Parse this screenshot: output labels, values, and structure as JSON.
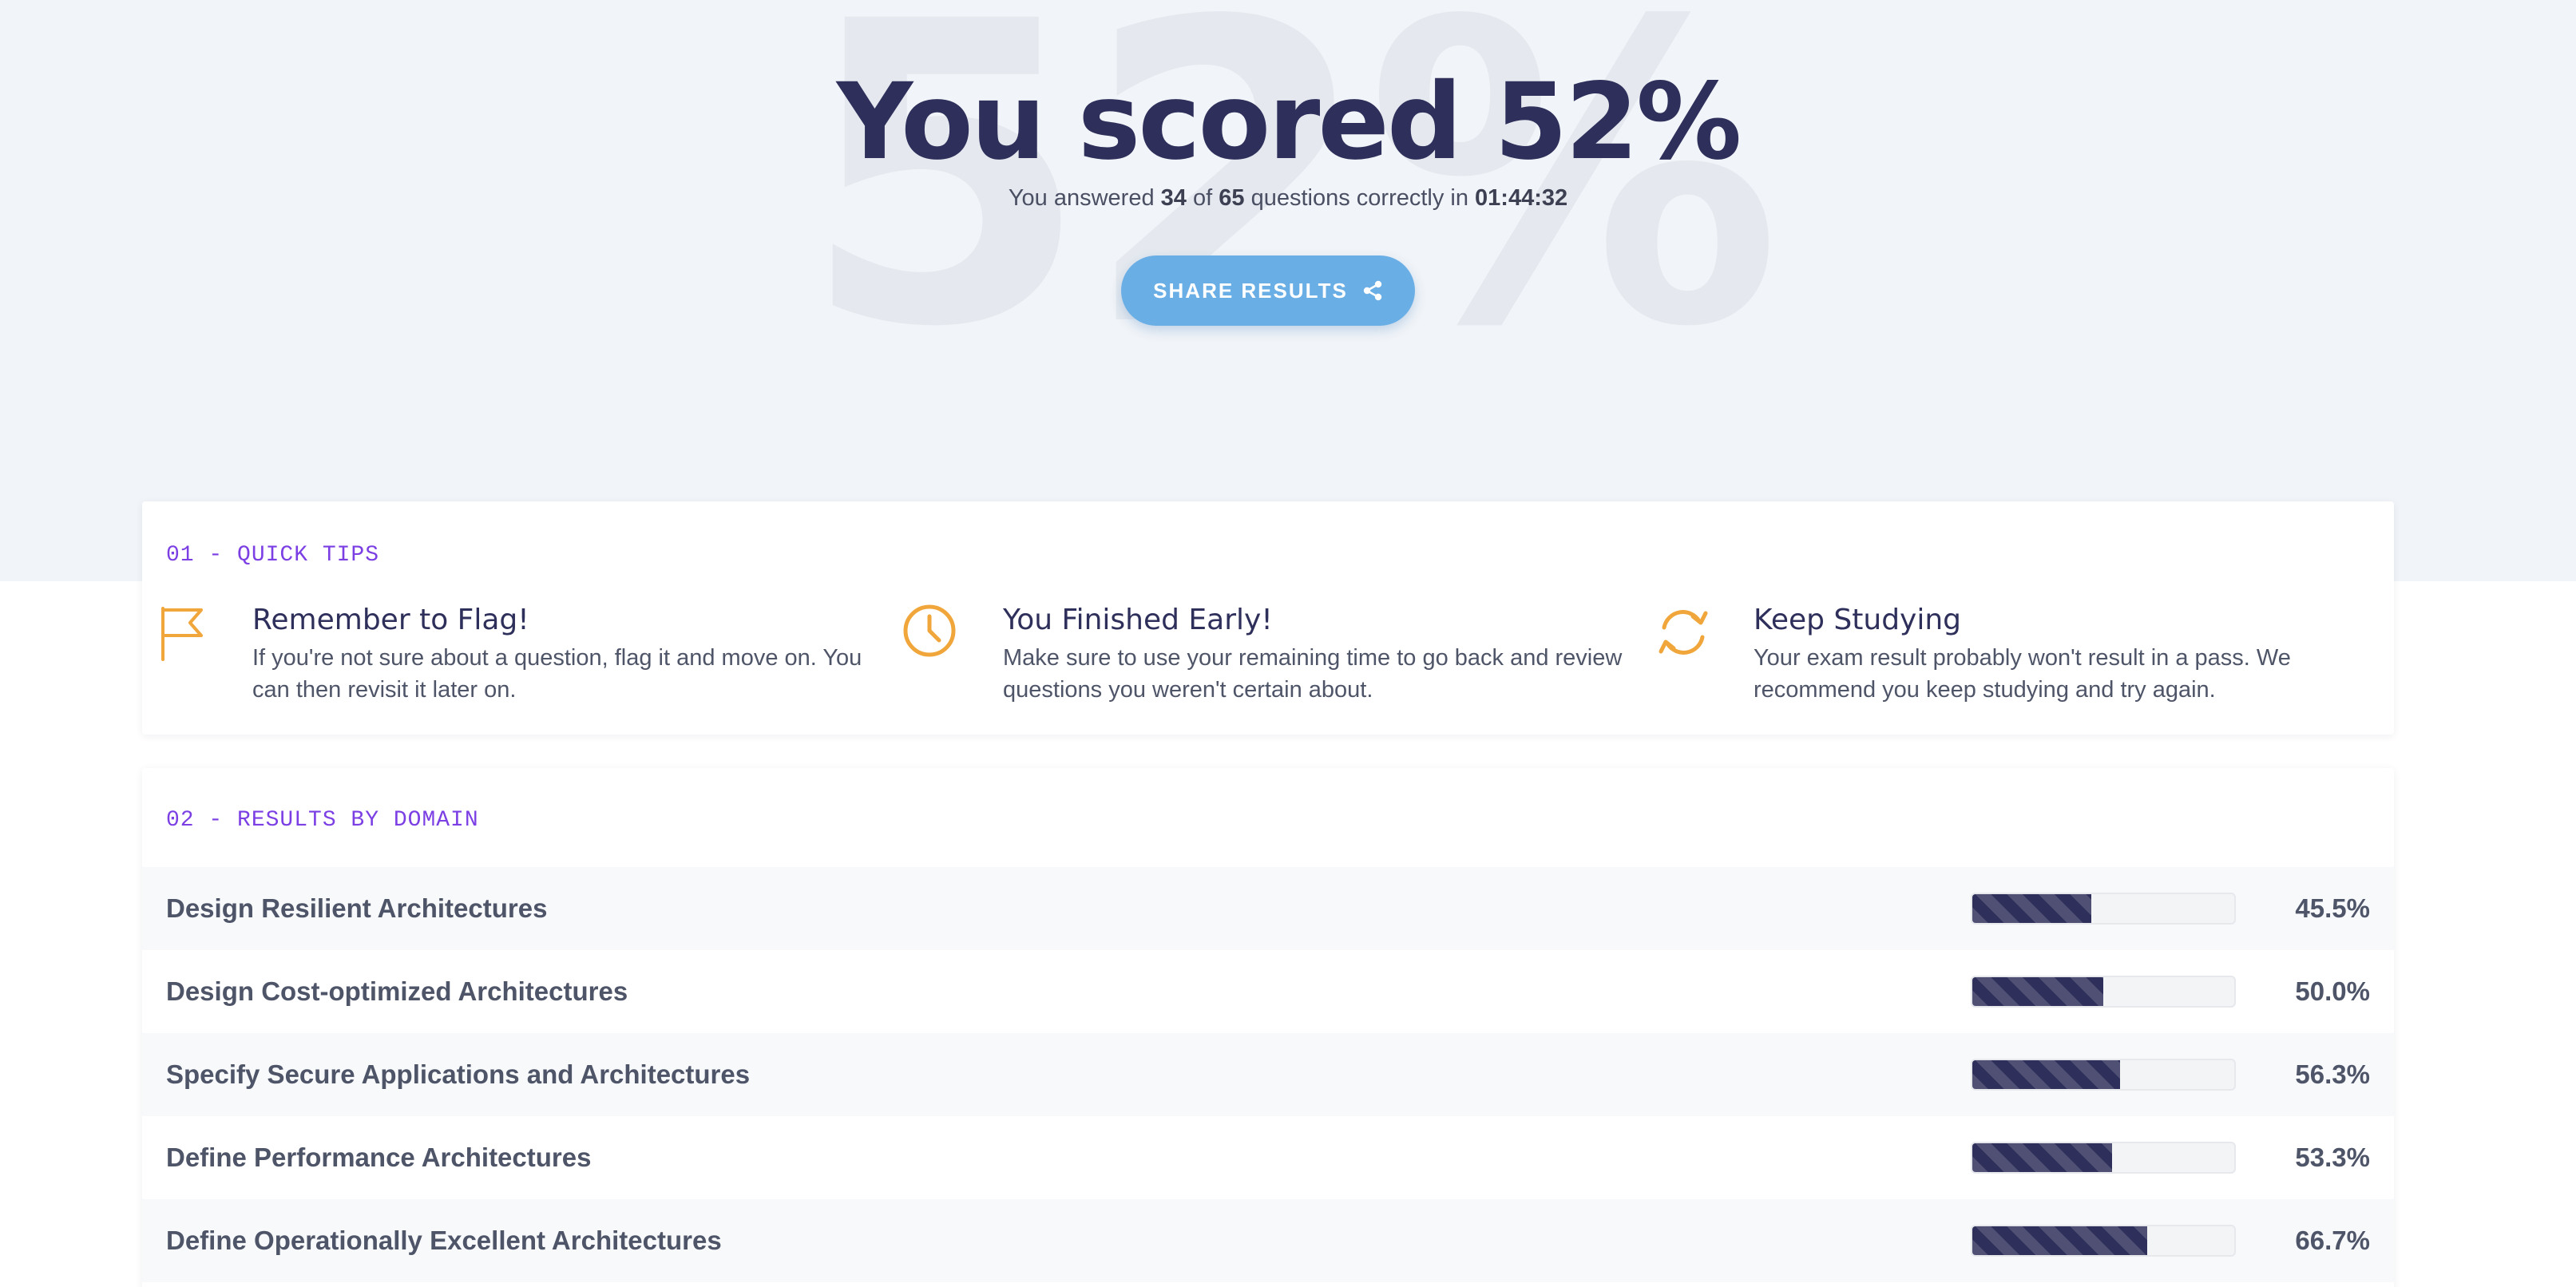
{
  "hero": {
    "background_text": "52%",
    "title": "You scored 52%",
    "sub": {
      "prefix": "You answered",
      "correct": "34",
      "of": "of",
      "total": "65",
      "middle": "questions correctly in",
      "time": "01:44:32"
    },
    "share_label": "SHARE RESULTS",
    "share_icon": "share-icon"
  },
  "tips": {
    "section_label": "01 - QUICK TIPS",
    "items": [
      {
        "icon": "flag-icon",
        "title": "Remember to Flag!",
        "text": "If you're not sure about a question, flag it and move on. You can then revisit it later on."
      },
      {
        "icon": "clock-icon",
        "title": "You Finished Early!",
        "text": "Make sure to use your remaining time to go back and review questions you weren't certain about."
      },
      {
        "icon": "refresh-icon",
        "title": "Keep Studying",
        "text": "Your exam result probably won't result in a pass. We recommend you keep studying and try again."
      }
    ]
  },
  "domains": {
    "section_label": "02 - RESULTS BY DOMAIN",
    "rows": [
      {
        "name": "Design Resilient Architectures",
        "score": 45.5,
        "percent_label": "45.5%"
      },
      {
        "name": "Design Cost-optimized Architectures",
        "score": 50.0,
        "percent_label": "50.0%"
      },
      {
        "name": "Specify Secure Applications and Architectures",
        "score": 56.3,
        "percent_label": "56.3%"
      },
      {
        "name": "Define Performance Architectures",
        "score": 53.3,
        "percent_label": "53.3%"
      },
      {
        "name": "Define Operationally Excellent Architectures",
        "score": 66.7,
        "percent_label": "66.7%"
      }
    ]
  },
  "colors": {
    "accent_purple": "#7b3fe4",
    "icon_orange": "#f0a63a",
    "button_blue": "#6aaee6",
    "bar_fill": "#2e2f5a",
    "title_navy": "#2e2f5a"
  }
}
